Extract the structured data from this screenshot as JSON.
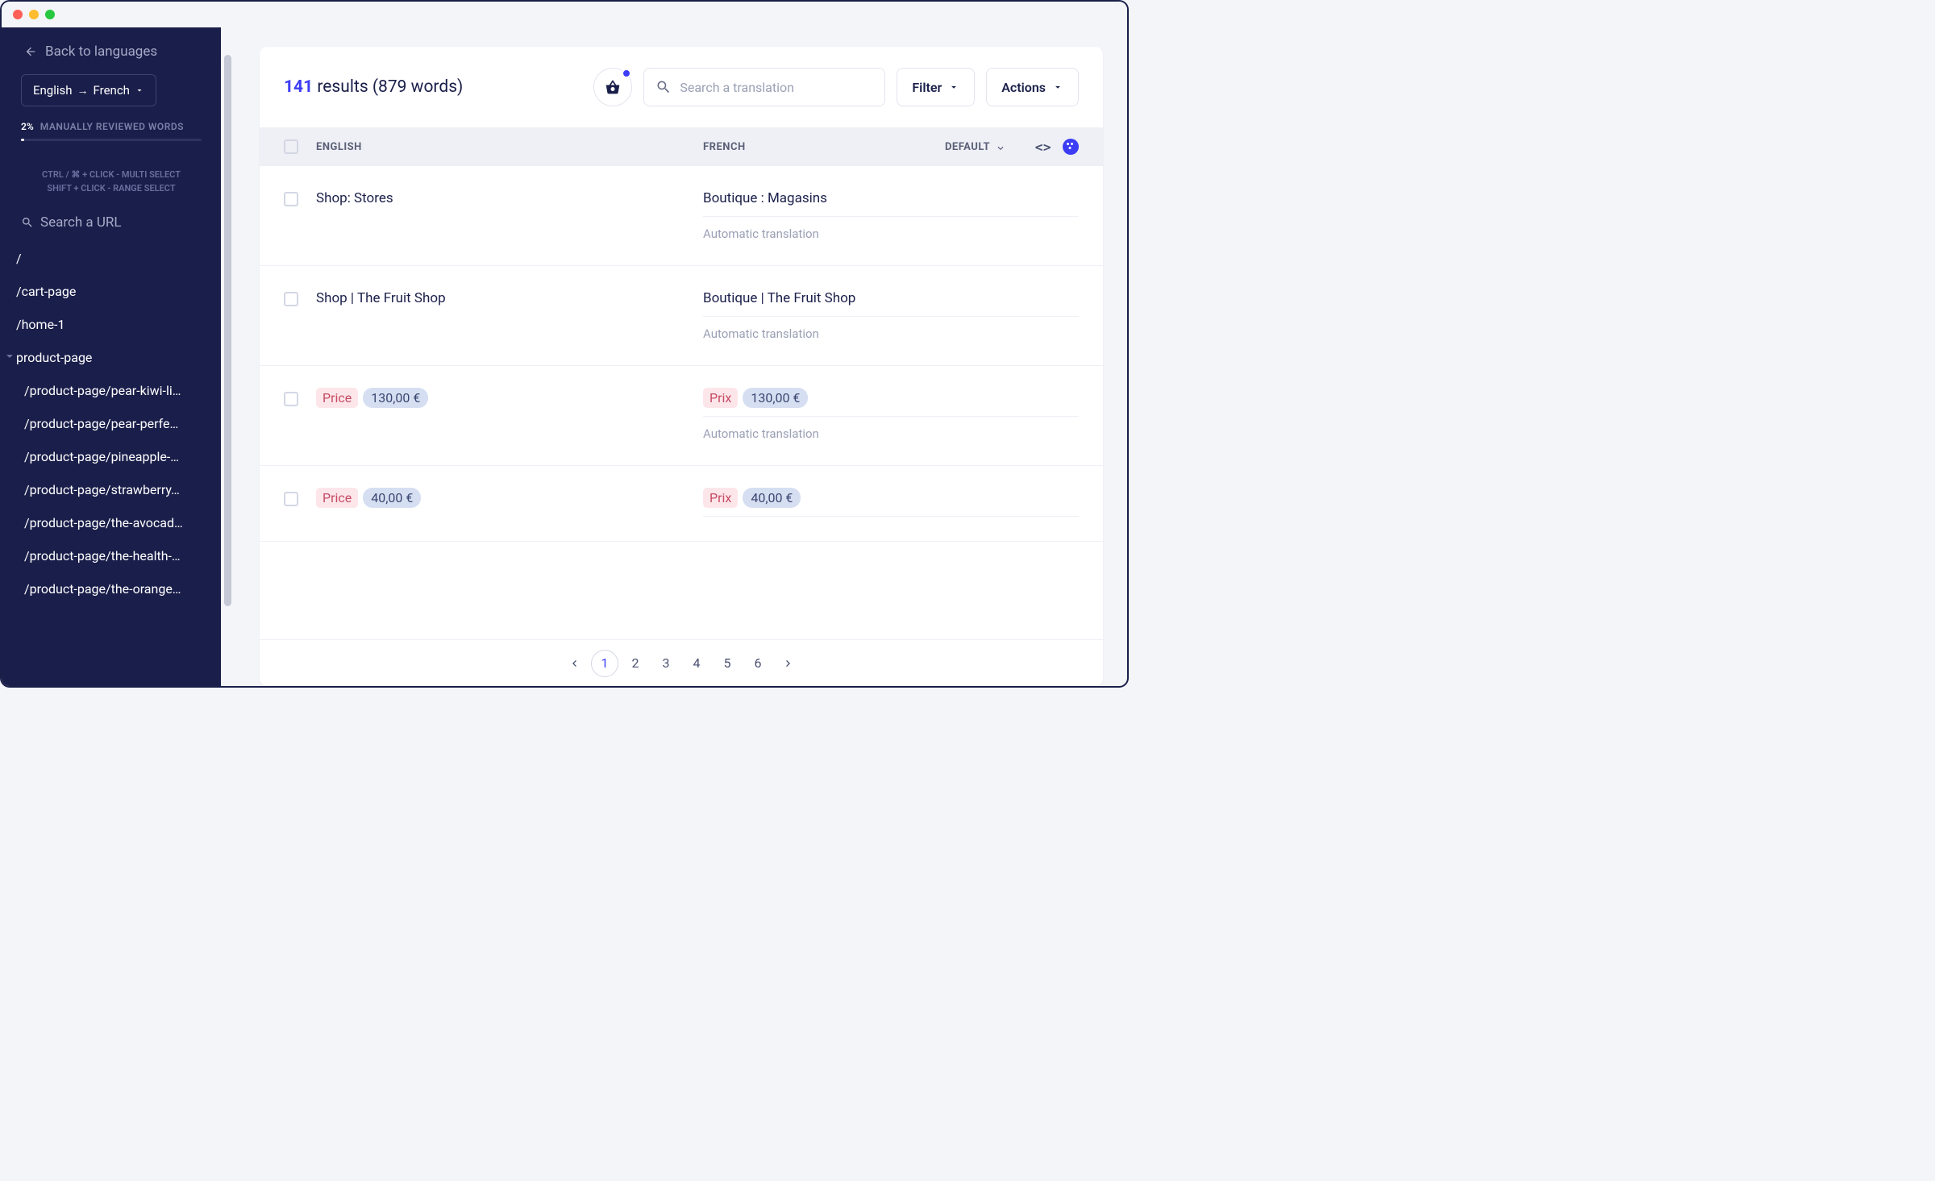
{
  "sidebar": {
    "back_label": "Back to languages",
    "lang_from": "English",
    "lang_to": "French",
    "progress_pct": "2%",
    "progress_label": "MANUALLY REVIEWED WORDS",
    "hint_line1": "CTRL / ⌘ + CLICK - MULTI SELECT",
    "hint_line2": "SHIFT + CLICK - RANGE SELECT",
    "url_search_placeholder": "Search a URL",
    "urls": [
      "/",
      "/cart-page",
      "/home-1",
      "product-page",
      "/product-page/pear-kiwi-li…",
      "/product-page/pear-perfe…",
      "/product-page/pineapple-…",
      "/product-page/strawberry…",
      "/product-page/the-avocad…",
      "/product-page/the-health-…",
      "/product-page/the-orange…"
    ]
  },
  "header": {
    "count": "141",
    "results_text": "results (879 words)",
    "search_placeholder": "Search a translation",
    "filter_label": "Filter",
    "actions_label": "Actions"
  },
  "table": {
    "col_english": "ENGLISH",
    "col_french": "FRENCH",
    "col_default": "DEFAULT"
  },
  "rows": [
    {
      "en": "Shop: Stores",
      "fr": "Boutique : Magasins",
      "note": "Automatic translation",
      "price": false
    },
    {
      "en": "Shop | The Fruit Shop",
      "fr": "Boutique | The Fruit Shop",
      "note": "Automatic translation",
      "price": false
    },
    {
      "en_label": "Price",
      "en_value": "130,00 €",
      "fr_label": "Prix",
      "fr_value": "130,00 €",
      "note": "Automatic translation",
      "price": true
    },
    {
      "en_label": "Price",
      "en_value": "40,00 €",
      "fr_label": "Prix",
      "fr_value": "40,00 €",
      "note": "",
      "price": true
    }
  ],
  "pagination": {
    "pages": [
      "1",
      "2",
      "3",
      "4",
      "5",
      "6"
    ],
    "active": "1"
  }
}
